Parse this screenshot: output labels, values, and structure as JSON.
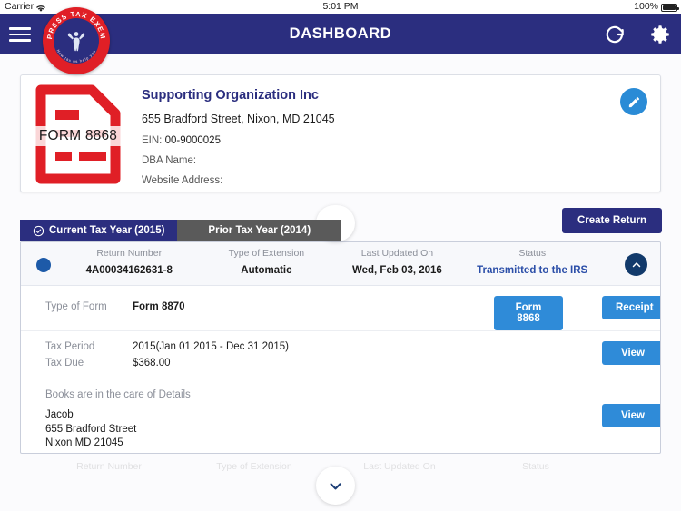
{
  "status_bar": {
    "carrier": "Carrier",
    "wifi_icon": "wifi-icon",
    "time": "5:01 PM",
    "battery_pct": "100%",
    "battery_icon": "battery-full-icon"
  },
  "navbar": {
    "menu_icon": "hamburger-menu-icon",
    "title": "DASHBOARD",
    "refresh_icon": "refresh-icon",
    "settings_icon": "gear-icon",
    "bg_color": "#2b2e7f"
  },
  "logo": {
    "name": "express-tax-exempt-logo",
    "ring_text": "EXPRESS TAX EXEMPT",
    "tagline": "Now tax us help you",
    "outer_color": "#e01f26",
    "inner_color": "#2b2e7f"
  },
  "org_card": {
    "form_icon_label": "FORM 8868",
    "form_icon_color": "#e01f26",
    "name": "Supporting Organization Inc",
    "address": "655 Bradford Street, Nixon, MD 21045",
    "ein_label": "EIN:",
    "ein_value": "00-9000025",
    "dba_label": "DBA Name:",
    "dba_value": "",
    "website_label": "Website Address:",
    "website_value": "",
    "edit_icon": "pencil-edit-icon",
    "accent_color": "#2b2e7f"
  },
  "collapse_top": {
    "icon": "chevron-up-icon"
  },
  "collapse_bottom": {
    "icon": "chevron-down-icon"
  },
  "tabs": [
    {
      "label": "Current Tax Year (2015)",
      "active": true,
      "icon": "check-circle-icon"
    },
    {
      "label": "Prior Tax Year (2014)",
      "active": false
    }
  ],
  "create_return_button": {
    "label": "Create Return"
  },
  "return": {
    "indicator": "status-dot",
    "collapse_icon": "chevron-up-icon",
    "columns": [
      {
        "label": "Return Number",
        "value": "4A00034162631-8",
        "link": false
      },
      {
        "label": "Type of Extension",
        "value": "Automatic",
        "link": false
      },
      {
        "label": "Last Updated On",
        "value": "Wed, Feb 03, 2016",
        "link": false
      },
      {
        "label": "Status",
        "value": "Transmitted to the IRS",
        "link": true
      }
    ],
    "form_row": {
      "key": "Type of Form",
      "value": "Form 8870",
      "button_form": "Form 8868",
      "button_receipt": "Receipt"
    },
    "period_row": {
      "period_key": "Tax Period",
      "period_value": "2015(Jan 01 2015 - Dec 31 2015)",
      "due_key": "Tax Due",
      "due_value": "$368.00",
      "button_view": "View"
    },
    "care_row": {
      "note": "Books are in the care of Details",
      "name": "Jacob",
      "street": "655 Bradford Street",
      "city_state_zip": "Nixon MD 21045",
      "button_view": "View"
    }
  },
  "ghost_row": {
    "c1": "Return Number",
    "c2": "Type of Extension",
    "c3": "Last Updated On",
    "c4": "Status"
  }
}
